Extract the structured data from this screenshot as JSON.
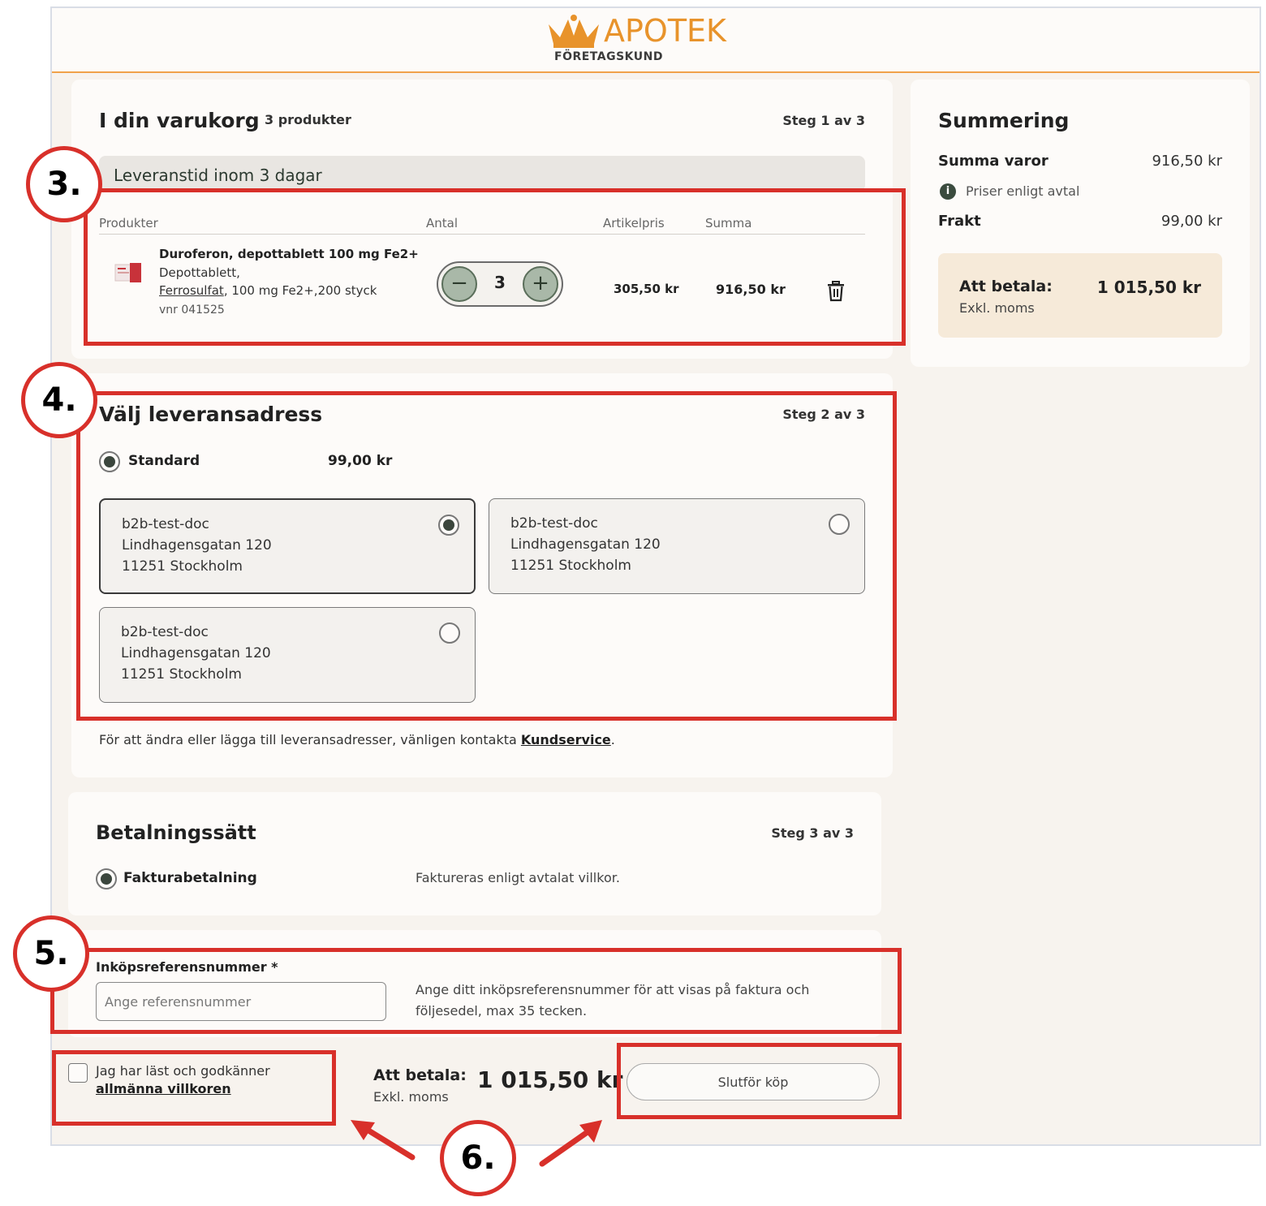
{
  "header": {
    "brand": "APOTEK",
    "subtitle": "FÖRETAGSKUND"
  },
  "cart": {
    "title": "I din varukorg",
    "count": "3 produkter",
    "step": "Steg 1 av 3",
    "delivery": "Leveranstid inom 3 dagar",
    "columns": {
      "product": "Produkter",
      "qty": "Antal",
      "price": "Artikelpris",
      "sum": "Summa"
    },
    "item": {
      "name": "Duroferon, depottablett 100 mg Fe2+",
      "type": "Depottablett,",
      "substance": "Ferrosulfat",
      "spec": ", 100 mg Fe2+,200 styck",
      "vnr": "vnr 041525",
      "quantity": "3",
      "unit_price": "305,50 kr",
      "sum": "916,50 kr"
    }
  },
  "summary": {
    "title": "Summering",
    "items_label": "Summa varor",
    "items_value": "916,50 kr",
    "note": "Priser enligt avtal",
    "shipping_label": "Frakt",
    "shipping_value": "99,00 kr",
    "pay_label": "Att betala:",
    "pay_value": "1 015,50 kr",
    "pay_note": "Exkl. moms"
  },
  "address": {
    "title": "Välj leveransadress",
    "step": "Steg 2 av 3",
    "shipping_option": "Standard",
    "shipping_price": "99,00 kr",
    "options": [
      {
        "name": "b2b-test-doc",
        "street": "Lindhagensgatan 120",
        "city": "11251 Stockholm"
      },
      {
        "name": "b2b-test-doc",
        "street": "Lindhagensgatan 120",
        "city": "11251 Stockholm"
      },
      {
        "name": "b2b-test-doc",
        "street": "Lindhagensgatan 120",
        "city": "11251 Stockholm"
      }
    ],
    "info": "För att ändra eller lägga till leveransadresser, vänligen kontakta ",
    "info_link": "Kundservice",
    "info_end": "."
  },
  "payment": {
    "title": "Betalningssätt",
    "step": "Steg 3 av 3",
    "method": "Fakturabetalning",
    "note": "Faktureras enligt avtalat villkor."
  },
  "reference": {
    "label": "Inköpsreferensnummer *",
    "placeholder": "Ange referensnummer",
    "help_line1": "Ange ditt inköpsreferensnummer för att visas på faktura och",
    "help_line2": "följesedel, max 35 tecken."
  },
  "footer": {
    "terms_text": "Jag har läst och godkänner",
    "terms_link": "allmänna villkoren",
    "pay_label": "Att betala:",
    "pay_note": "Exkl. moms",
    "pay_value": "1 015,50 kr",
    "finish_button": "Slutför köp"
  },
  "annotations": [
    "3.",
    "4.",
    "5.",
    "6."
  ],
  "colors": {
    "accent": "#e8932b",
    "annotation": "#d8302a",
    "radio": "#3b463d"
  }
}
